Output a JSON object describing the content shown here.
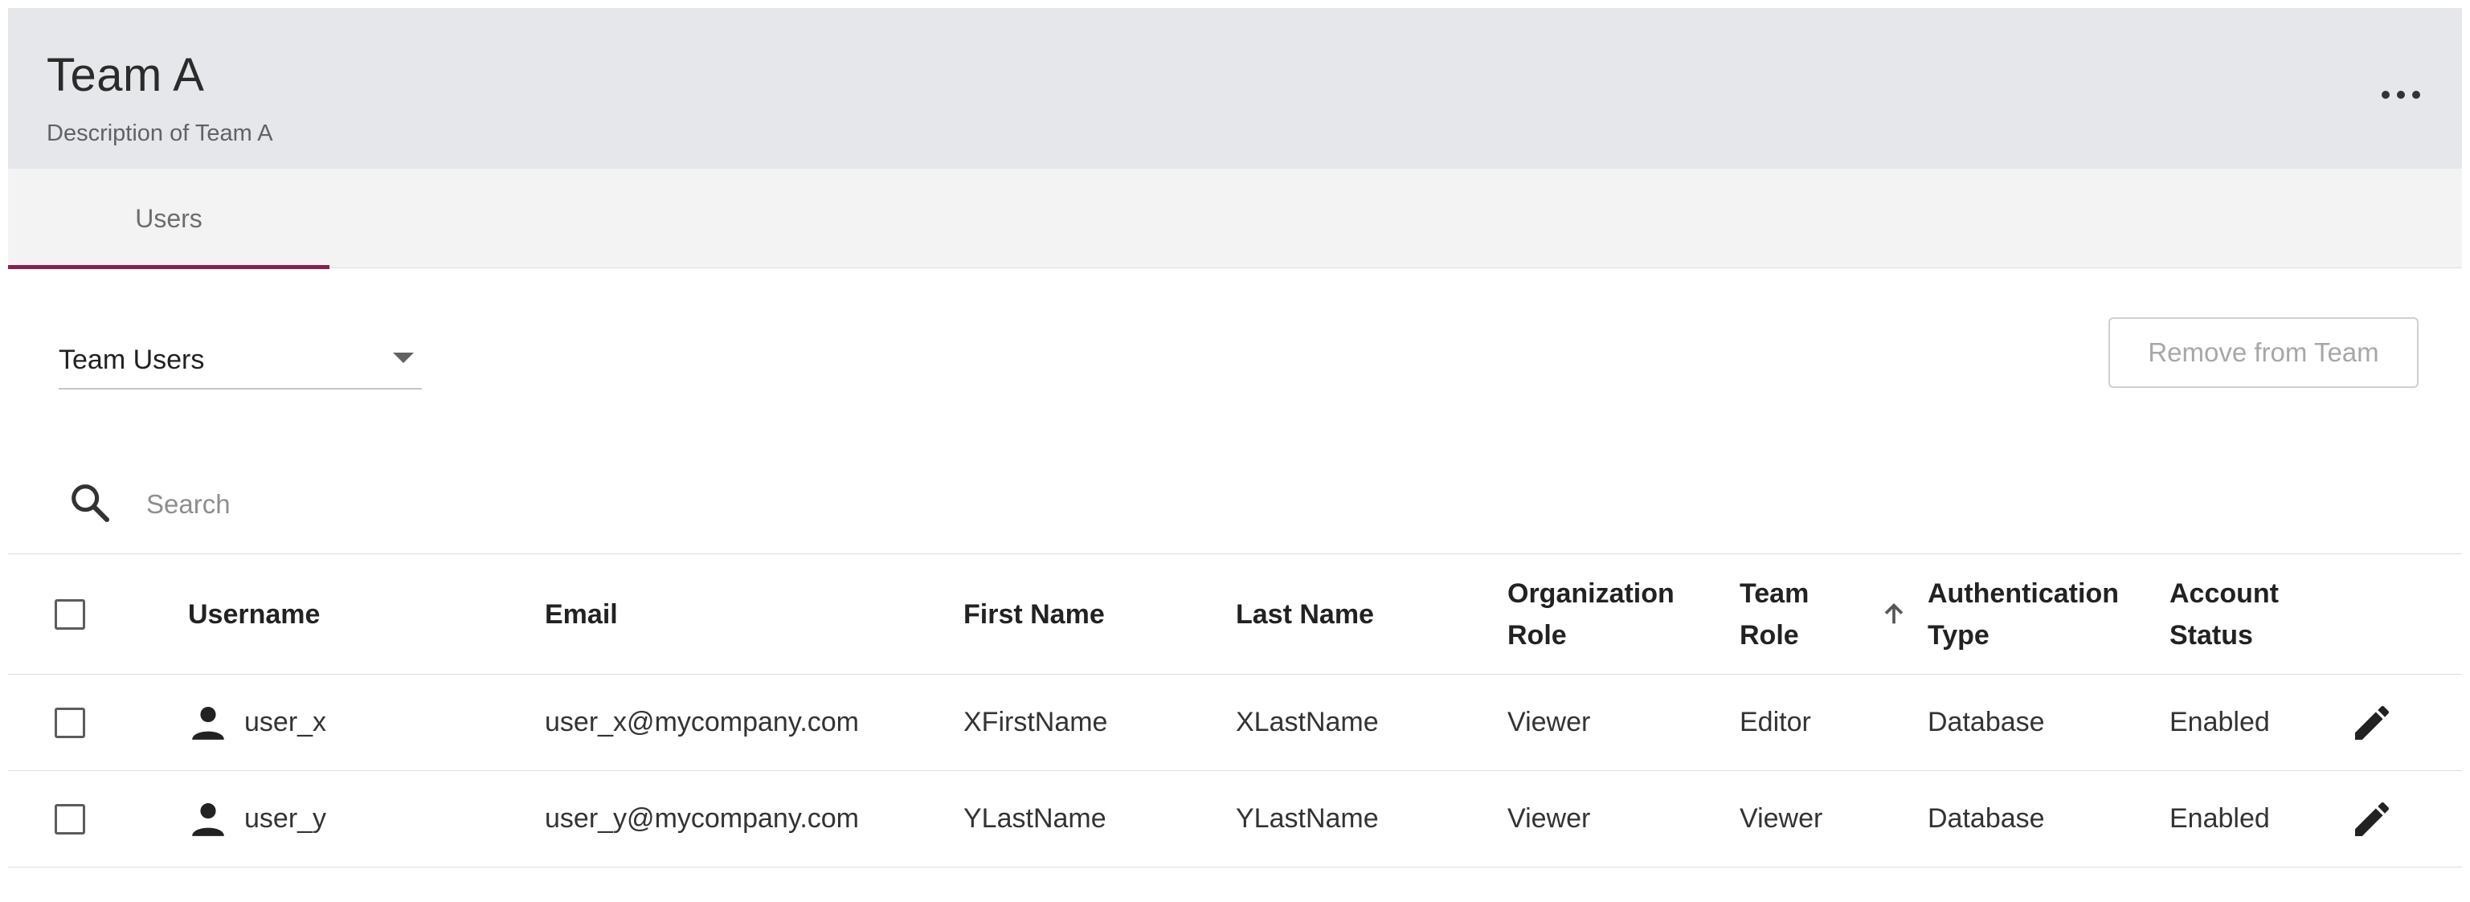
{
  "header": {
    "title": "Team A",
    "description": "Description of Team A"
  },
  "tabs": [
    {
      "label": "Users",
      "active": true
    }
  ],
  "filter": {
    "selected": "Team Users"
  },
  "actions": {
    "remove_label": "Remove from Team"
  },
  "search": {
    "placeholder": "Search"
  },
  "table": {
    "columns": [
      {
        "key": "username",
        "label": "Username"
      },
      {
        "key": "email",
        "label": "Email"
      },
      {
        "key": "first_name",
        "label": "First Name"
      },
      {
        "key": "last_name",
        "label": "Last Name"
      },
      {
        "key": "org_role",
        "label": "Organization Role"
      },
      {
        "key": "team_role",
        "label": "Team Role"
      },
      {
        "key": "auth_type",
        "label": "Authentication Type"
      },
      {
        "key": "status",
        "label": "Account Status"
      }
    ],
    "sort_indicator": "arrow-up-icon",
    "rows": [
      {
        "username": "user_x",
        "email": "user_x@mycompany.com",
        "first_name": "XFirstName",
        "last_name": "XLastName",
        "org_role": "Viewer",
        "team_role": "Editor",
        "auth_type": "Database",
        "status": "Enabled"
      },
      {
        "username": "user_y",
        "email": "user_y@mycompany.com",
        "first_name": "YLastName",
        "last_name": "YLastName",
        "org_role": "Viewer",
        "team_role": "Viewer",
        "auth_type": "Database",
        "status": "Enabled"
      }
    ]
  },
  "colors": {
    "header_bg": "#e6e7eb",
    "tab_bar_bg": "#f3f3f4",
    "accent": "#8b1e4f"
  }
}
